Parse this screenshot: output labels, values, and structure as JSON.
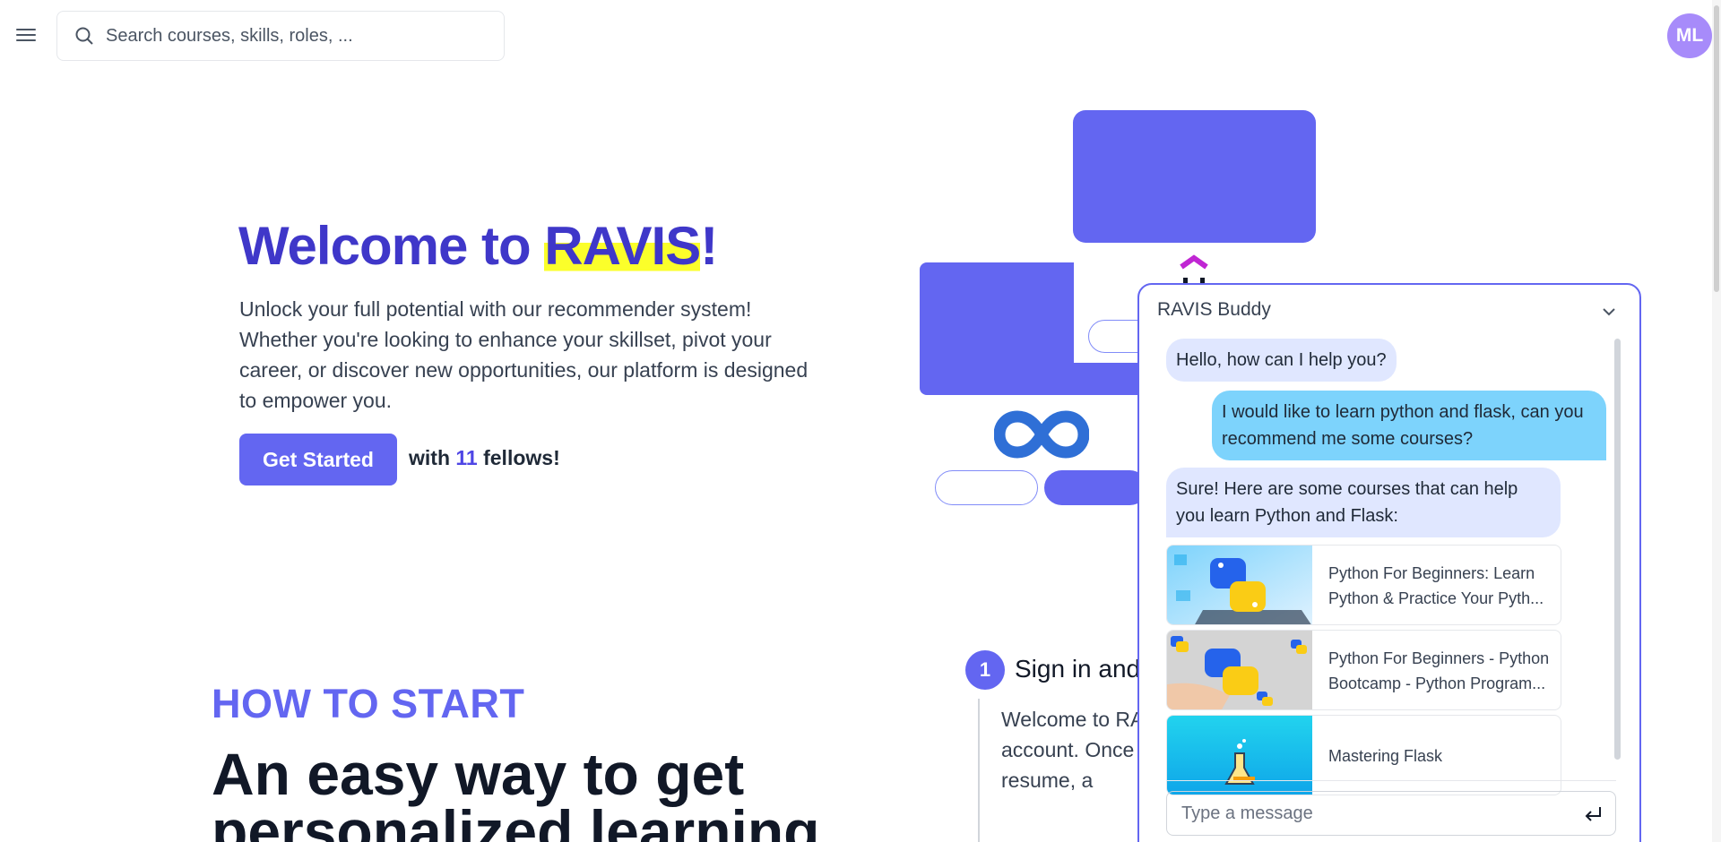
{
  "search": {
    "placeholder": "Search courses, skills, roles, ..."
  },
  "user": {
    "initials": "ML"
  },
  "hero": {
    "title_prefix": "Welcome to ",
    "title_brand": "RAVIS",
    "title_suffix": "!",
    "description": "Unlock your full potential with our recommender system! Whether you're looking to enhance your skillset, pivot your career, or discover new opportunities, our platform is designed to empower you.",
    "cta_label": "Get Started",
    "fellows_prefix": "with ",
    "fellows_count": "11",
    "fellows_suffix": " fellows!"
  },
  "how_to_start": {
    "label": "HOW TO START",
    "title": "An easy way to get personalized learning"
  },
  "step": {
    "number": "1",
    "title": "Sign in and",
    "text": "Welcome to RA learning journe account. Once showcase you your resume, a"
  },
  "chat": {
    "title": "RAVIS Buddy",
    "messages": [
      {
        "from": "bot",
        "text": "Hello, how can I help you?"
      },
      {
        "from": "user",
        "text": "I would like to learn python and flask, can you recommend me some courses?"
      },
      {
        "from": "bot",
        "text": "Sure! Here are some courses that can help you learn Python and Flask:"
      }
    ],
    "courses": [
      {
        "title": "Python For Beginners: Learn Python & Practice Your Pyth..."
      },
      {
        "title": "Python For Beginners - Python Bootcamp - Python Program..."
      },
      {
        "title": "Mastering Flask"
      }
    ],
    "input_placeholder": "Type a message"
  },
  "colors": {
    "primary": "#6366f1",
    "heading": "#3f37c9",
    "highlight": "#fbff2a",
    "bot_bubble": "#e0e7ff",
    "user_bubble": "#7dd3fc",
    "avatar": "#a78bfa"
  }
}
